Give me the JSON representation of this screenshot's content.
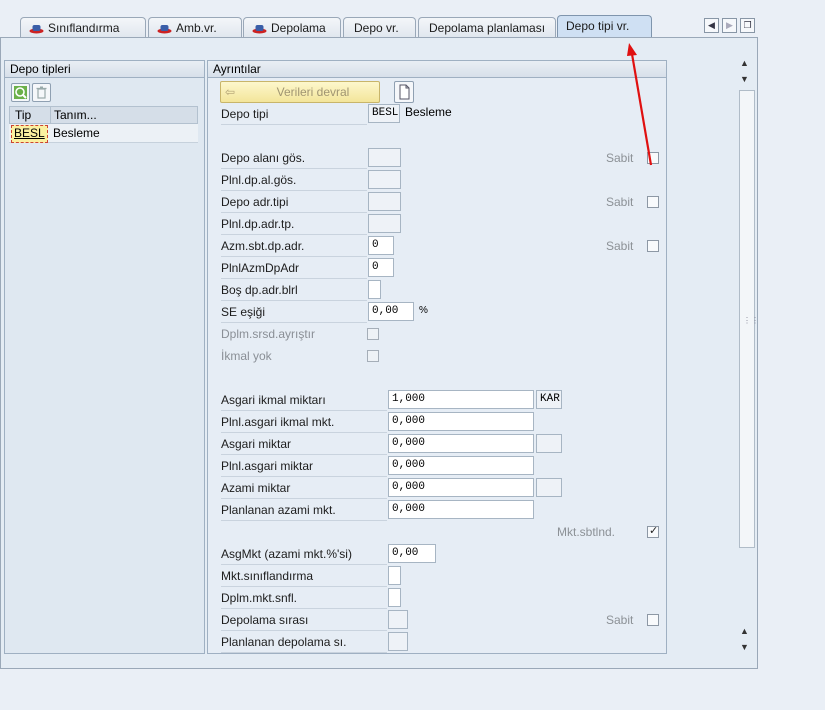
{
  "tabs": [
    {
      "label": "Sınıflandırma",
      "icon": "hat-icon",
      "active": false
    },
    {
      "label": "Amb.vr.",
      "icon": "hat-icon",
      "active": false
    },
    {
      "label": "Depolama",
      "icon": "hat-icon",
      "active": false
    },
    {
      "label": "Depo vr.",
      "active": false
    },
    {
      "label": "Depolama planlaması",
      "active": false
    },
    {
      "label": "Depo tipi vr.",
      "active": true
    }
  ],
  "left_panel": {
    "title": "Depo tipleri",
    "columns": [
      "Tip",
      "Tanım..."
    ],
    "rows": [
      {
        "tip": "BESL",
        "tanim": "Besleme"
      }
    ]
  },
  "right_panel": {
    "title": "Ayrıntılar",
    "transfer_button": "Verileri devral",
    "depo_tipi_label": "Depo tipi",
    "depo_tipi_value": "BESL",
    "depo_tipi_desc": "Besleme",
    "fields": {
      "depo_alani_gos": {
        "label": "Depo alanı gös.",
        "value": ""
      },
      "plnl_dp_al_gos": {
        "label": "Plnl.dp.al.gös.",
        "value": ""
      },
      "depo_adr_tipi": {
        "label": "Depo adr.tipi",
        "value": ""
      },
      "plnl_dp_adr_tp": {
        "label": "Plnl.dp.adr.tp.",
        "value": ""
      },
      "azm_sbt": {
        "label": "Azm.sbt.dp.adr.",
        "value": "0"
      },
      "plnl_azm": {
        "label": "PlnlAzmDpAdr",
        "value": "0"
      },
      "bos_dp": {
        "label": "Boş dp.adr.blrl",
        "value": ""
      },
      "se_esigi": {
        "label": "SE eşiği",
        "value": "0,00",
        "unit": "%"
      },
      "dplm_srsd": {
        "label": "Dplm.srsd.ayrıştır"
      },
      "ikmal_yok": {
        "label": "İkmal yok"
      },
      "asgari_ikmal": {
        "label": "Asgari ikmal miktarı",
        "value": "1,000",
        "unit": "KAR"
      },
      "plnl_asgari_ikmal": {
        "label": "Plnl.asgari ikmal mkt.",
        "value": "0,000"
      },
      "asgari_miktar": {
        "label": "Asgari miktar",
        "value": "0,000"
      },
      "plnl_asgari_miktar": {
        "label": "Plnl.asgari miktar",
        "value": "0,000"
      },
      "azami_miktar": {
        "label": "Azami miktar",
        "value": "0,000"
      },
      "planlanan_azami": {
        "label": "Planlanan azami mkt.",
        "value": "0,000"
      },
      "mkt_sbtlnd": {
        "label": "Mkt.sbtlnd.",
        "checked": true
      },
      "asgmkt": {
        "label": "AsgMkt (azami mkt.%'si)",
        "value": "0,00"
      },
      "mkt_sinif": {
        "label": "Mkt.sınıflandırma",
        "value": ""
      },
      "dplm_mkt_snfl": {
        "label": "Dplm.mkt.snfl.",
        "value": ""
      },
      "depolama_sirasi": {
        "label": "Depolama sırası",
        "value": ""
      },
      "planlanan_depolama": {
        "label": "Planlanan depolama sı.",
        "value": ""
      }
    },
    "sabit_label": "Sabit"
  }
}
